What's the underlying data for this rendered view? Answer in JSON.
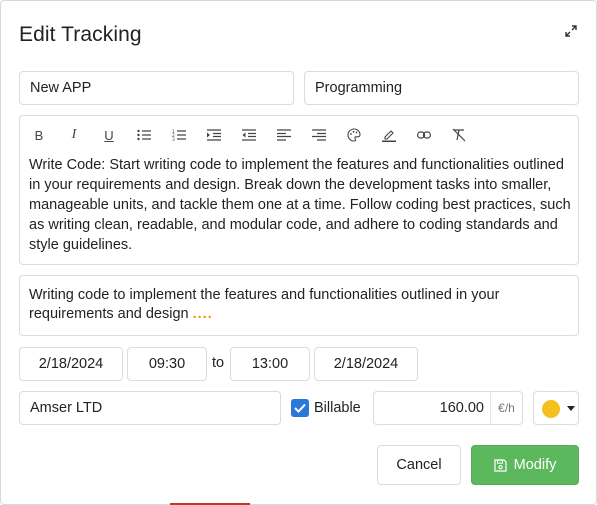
{
  "dialog": {
    "title": "Edit Tracking",
    "expand_icon": "expand-arrows-icon"
  },
  "project": {
    "value": "New APP"
  },
  "category": {
    "value": "Programming"
  },
  "editor": {
    "toolbar": [
      {
        "name": "bold-icon",
        "label": "B"
      },
      {
        "name": "italic-icon",
        "label": "I"
      },
      {
        "name": "underline-icon",
        "label": "U"
      },
      {
        "name": "bullet-list-icon"
      },
      {
        "name": "numbered-list-icon"
      },
      {
        "name": "indent-icon"
      },
      {
        "name": "outdent-icon"
      },
      {
        "name": "align-left-icon"
      },
      {
        "name": "align-right-icon"
      },
      {
        "name": "palette-icon"
      },
      {
        "name": "highlight-pen-icon"
      },
      {
        "name": "link-icon"
      },
      {
        "name": "clear-format-icon"
      }
    ],
    "content": "Write Code: Start writing code to implement the features and functionalities outlined in your requirements and design. Break down the development tasks into smaller, manageable units, and tackle them one at a time. Follow coding best practices, such as writing clean, readable, and modular code, and adhere to coding standards and style guidelines."
  },
  "description": {
    "text": "Writing code to implement the features and functionalities outlined in your requirements and design",
    "more": "...."
  },
  "time": {
    "start_date": "2/18/2024",
    "start_time": "09:30",
    "to_label": "to",
    "end_time": "13:00",
    "end_date": "2/18/2024"
  },
  "client": {
    "value": "Amser LTD"
  },
  "billable": {
    "label": "Billable",
    "checked": true
  },
  "rate": {
    "value": "160.00",
    "unit": "€/h"
  },
  "color": {
    "selected": "#f4c01e"
  },
  "actions": {
    "cancel_label": "Cancel",
    "modify_label": "Modify"
  },
  "colors": {
    "primary_green": "#5cb85c",
    "checkbox_blue": "#2a78d8"
  }
}
